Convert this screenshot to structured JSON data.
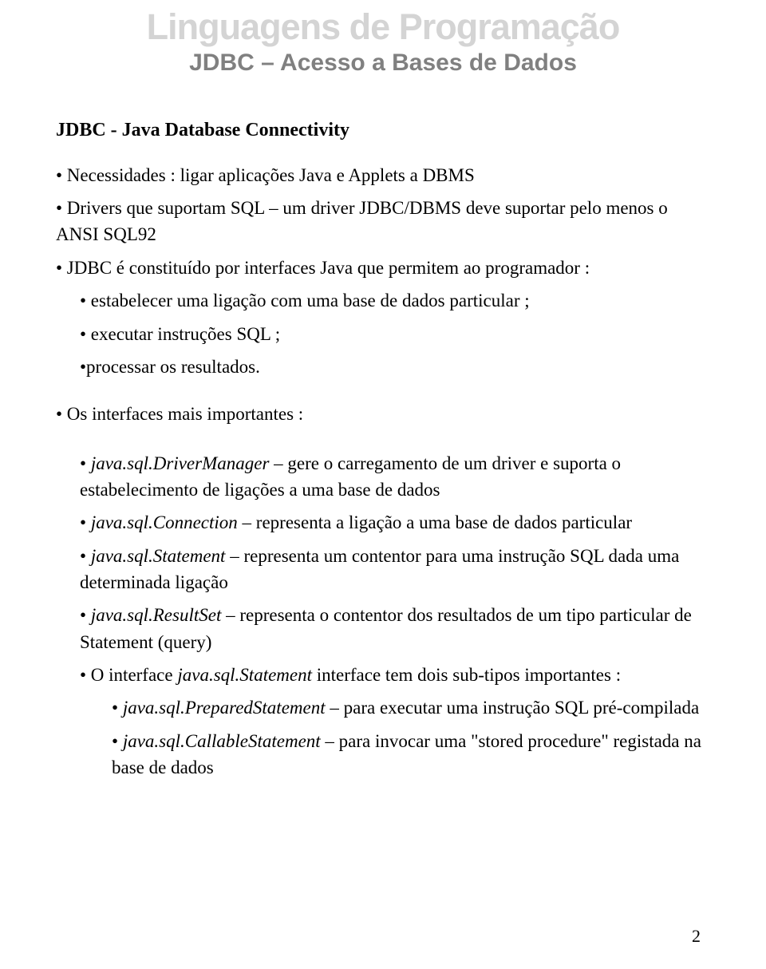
{
  "header": {
    "title": "Linguagens de Programação",
    "subtitle": "JDBC – Acesso a Bases de Dados"
  },
  "section": {
    "title": "JDBC - Java Database Connectivity"
  },
  "intro": {
    "b1": "• Necessidades : ligar aplicações Java e Applets a DBMS",
    "b2": "• Drivers que suportam SQL – um driver JDBC/DBMS deve suportar pelo menos o ANSI SQL92",
    "b3": "• JDBC é constituído por interfaces Java que permitem ao programador :",
    "b3a": "• estabelecer uma ligação com uma base de dados particular ;",
    "b3b": "• executar instruções SQL ;",
    "b3c": "•processar os resultados."
  },
  "interfaces_heading": "• Os interfaces mais importantes :",
  "iface": {
    "dm_pre": "• ",
    "dm_em": "java.sql.DriverManager",
    "dm_post": " – gere o carregamento de um driver e suporta o estabelecimento de ligações a uma base de dados",
    "conn_pre": "• ",
    "conn_em": "java.sql.Connection",
    "conn_post": " – representa a ligação a uma base de dados particular",
    "stmt_pre": "• ",
    "stmt_em": "java.sql.Statement",
    "stmt_post": " – representa um contentor para uma instrução SQL dada uma determinada ligação",
    "rs_pre": "• ",
    "rs_em": "java.sql.ResultSet",
    "rs_post": " – representa o contentor dos resultados de um tipo particular de Statement (query)",
    "sub_pre": "• O interface ",
    "sub_em": "java.sql.Statement",
    "sub_post": " interface tem dois sub-tipos importantes :",
    "ps_pre": "• ",
    "ps_em": "java.sql.PreparedStatement",
    "ps_post": " – para executar uma instrução SQL pré-compilada",
    "cs_pre": "• ",
    "cs_em": "java.sql.CallableStatement",
    "cs_post": " – para invocar uma \"stored procedure\" registada na base de dados"
  },
  "page_number": "2"
}
